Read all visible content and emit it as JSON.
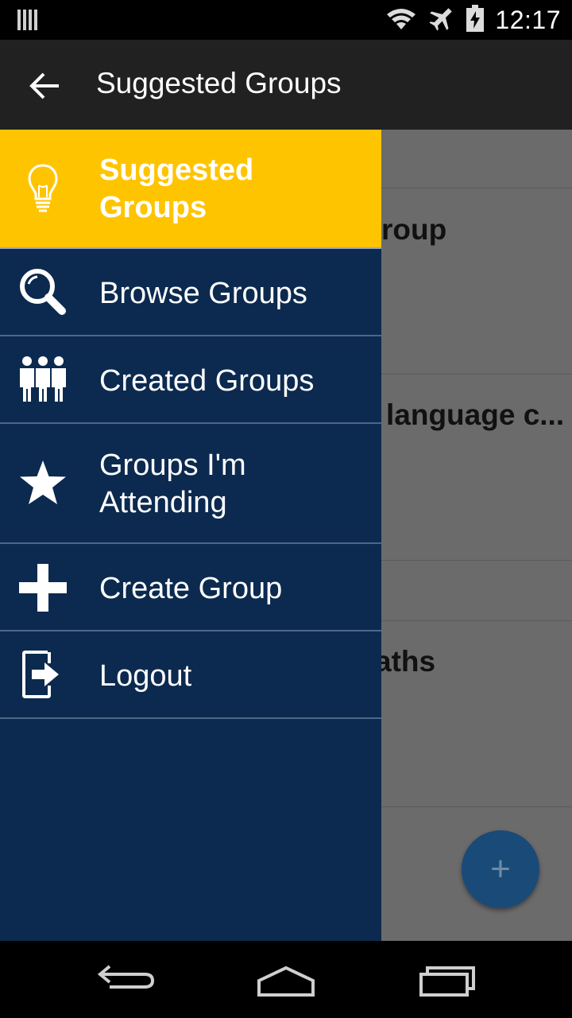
{
  "status_bar": {
    "time": "12:17",
    "icons": [
      "signal-bars-icon",
      "wifi-icon",
      "airplane-mode-icon",
      "battery-charging-icon"
    ]
  },
  "toolbar": {
    "back_icon": "arrow-back-icon",
    "title": "Suggested Groups"
  },
  "background_list": {
    "rows": [
      {
        "visible_text": "roup"
      },
      {
        "visible_text": "language c..."
      },
      {
        "visible_text": "aths"
      }
    ],
    "fab_label": "+"
  },
  "drawer": {
    "items": [
      {
        "label": "Suggested Groups",
        "icon": "lightbulb-icon",
        "active": true
      },
      {
        "label": "Browse Groups",
        "icon": "search-icon",
        "active": false
      },
      {
        "label": "Created Groups",
        "icon": "people-group-icon",
        "active": false
      },
      {
        "label": "Groups I'm Attending",
        "icon": "star-icon",
        "active": false
      },
      {
        "label": "Create Group",
        "icon": "plus-icon",
        "active": false
      },
      {
        "label": "Logout",
        "icon": "logout-icon",
        "active": false
      }
    ]
  },
  "nav_bar": {
    "icons": [
      "nav-back-icon",
      "nav-home-icon",
      "nav-recents-icon"
    ]
  },
  "colors": {
    "drawer_bg": "#0c2a4f",
    "active_item_bg": "#ffc400",
    "toolbar_bg": "#212121"
  }
}
